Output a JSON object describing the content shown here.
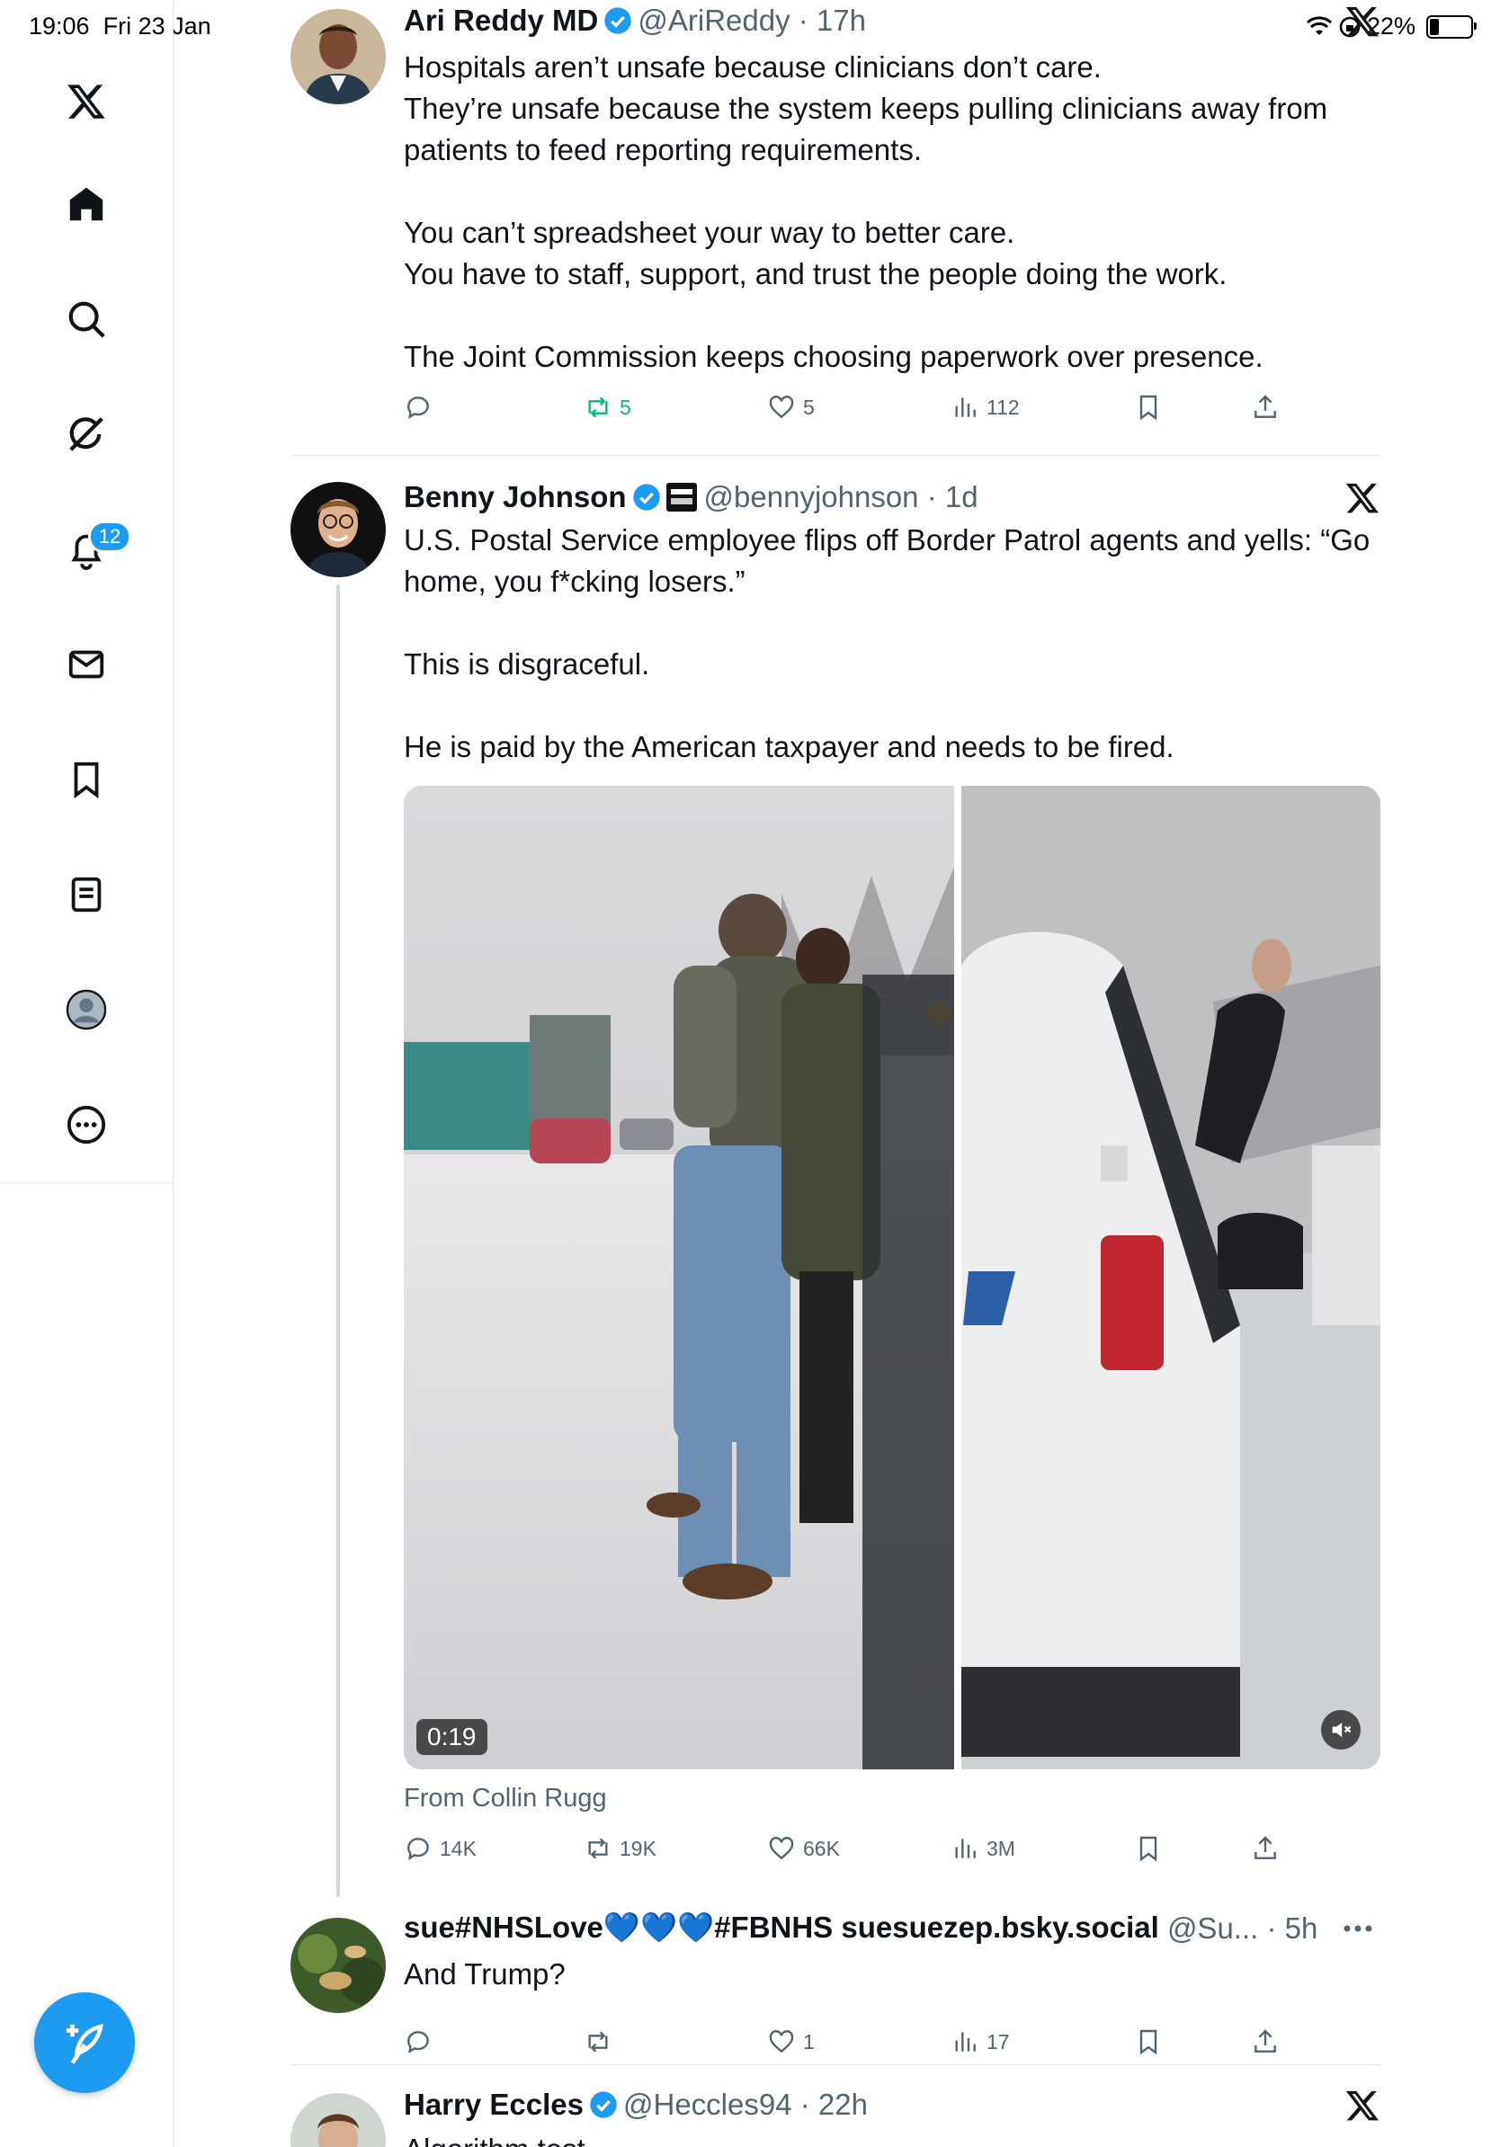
{
  "status_bar": {
    "time": "19:06",
    "date": "Fri 23 Jan",
    "battery": "22%",
    "indicators": [
      "wifi-icon",
      "orientation-lock-icon"
    ]
  },
  "sidebar": {
    "items": [
      {
        "name": "x-logo-icon"
      },
      {
        "name": "home-icon"
      },
      {
        "name": "search-icon"
      },
      {
        "name": "grok-icon"
      },
      {
        "name": "notifications-icon",
        "badge": "12"
      },
      {
        "name": "messages-icon"
      },
      {
        "name": "bookmarks-icon"
      },
      {
        "name": "lists-icon"
      },
      {
        "name": "profile-icon"
      },
      {
        "name": "more-icon"
      }
    ],
    "compose_label": "compose-icon"
  },
  "tweets": [
    {
      "name": "Ari Reddy MD",
      "handle": "@AriReddy",
      "time": "17h",
      "body": "Hospitals aren’t unsafe because clinicians don’t care.\nThey’re unsafe because the system keeps pulling clinicians away from patients to feed reporting requirements.\n\nYou can’t spreadsheet your way to better care.\nYou have to staff, support, and trust the people doing the work.\n\nThe Joint Commission keeps choosing paperwork over presence.",
      "replies": "",
      "reposts": "5",
      "likes": "5",
      "views": "112"
    },
    {
      "name": "Benny Johnson",
      "handle": "@bennyjohnson",
      "time": "1d",
      "body": "U.S. Postal Service employee flips off Border Patrol agents and yells: “Go home, you f*cking losers.”\n\nThis is disgraceful.\n\nHe is paid by the American taxpayer and needs to be fired.",
      "video_duration": "0:19",
      "from": "From Collin Rugg",
      "replies": "14K",
      "reposts": "19K",
      "likes": "66K",
      "views": "3M"
    },
    {
      "name": "sue#NHSLove💙💙💙#FBNHS suesuezep.bsky.social",
      "handle": "@Su...",
      "time": "5h",
      "body": "And Trump?",
      "replies": "",
      "reposts": "",
      "likes": "1",
      "views": "17"
    },
    {
      "name": "Harry Eccles",
      "handle": "@Heccles94",
      "time": "22h",
      "body": "Algorithm test"
    }
  ],
  "colors": {
    "accent": "#1d9bf0",
    "repost_active": "#00ba7c",
    "secondary_text": "#536471"
  }
}
